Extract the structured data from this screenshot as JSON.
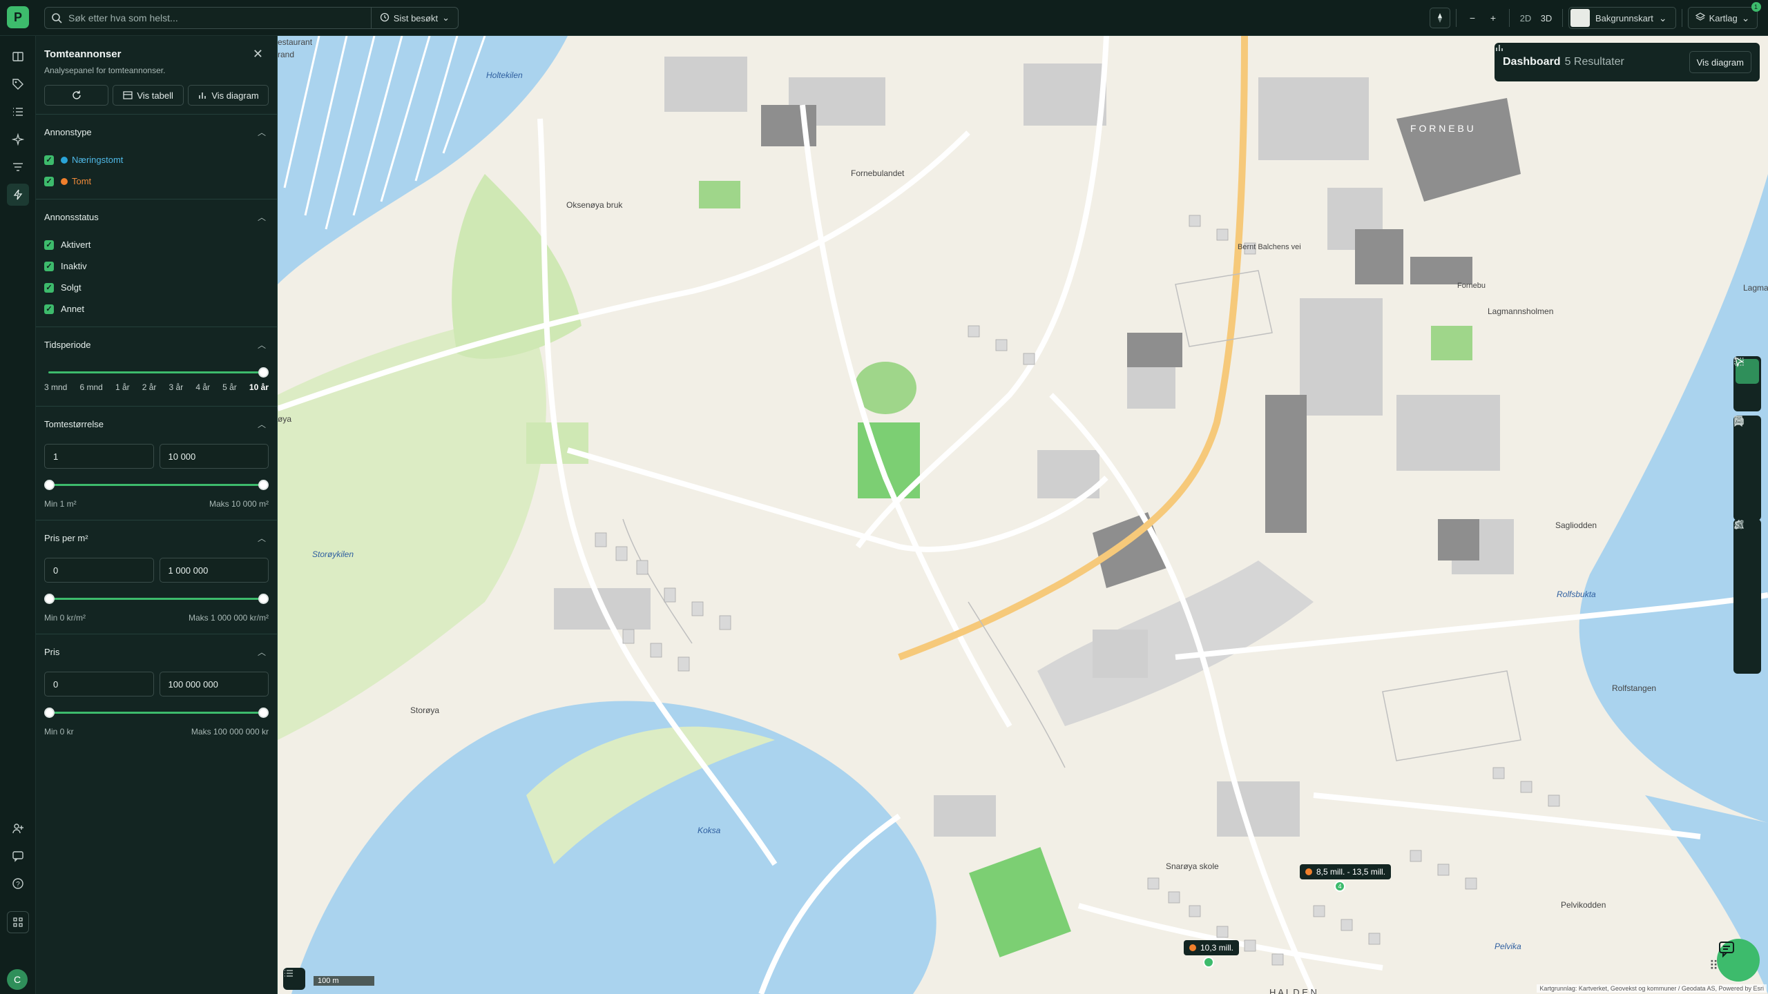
{
  "topbar": {
    "logo": "P",
    "search_placeholder": "Søk etter hva som helst...",
    "recent_label": "Sist besøkt",
    "zoom_out": "−",
    "zoom_in": "+",
    "mode_2d": "2D",
    "mode_3d": "3D",
    "basemap_label": "Bakgrunnskart",
    "layers_label": "Kartlag",
    "layers_badge": "1"
  },
  "user": {
    "initial": "C"
  },
  "panel": {
    "title": "Tomteannonser",
    "subtitle": "Analysepanel for tomteannonser.",
    "actions": {
      "table": "Vis tabell",
      "chart": "Vis diagram"
    },
    "annonstype": {
      "title": "Annonstype",
      "items": [
        {
          "label": "Næringstomt",
          "color": "#2aa4d8"
        },
        {
          "label": "Tomt",
          "color": "#ef7f2c"
        }
      ]
    },
    "status": {
      "title": "Annonsstatus",
      "items": [
        {
          "label": "Aktivert"
        },
        {
          "label": "Inaktiv"
        },
        {
          "label": "Solgt"
        },
        {
          "label": "Annet"
        }
      ]
    },
    "period": {
      "title": "Tidsperiode",
      "ticks": [
        "3 mnd",
        "6 mnd",
        "1 år",
        "2 år",
        "3 år",
        "4 år",
        "5 år",
        "10 år"
      ],
      "selected": "10 år"
    },
    "size": {
      "title": "Tomtestørrelse",
      "min": "1",
      "max": "10 000",
      "min_label": "Min 1 m²",
      "max_label": "Maks 10 000 m²"
    },
    "ppm": {
      "title": "Pris per m²",
      "min": "0",
      "max": "1 000 000",
      "min_label": "Min 0 kr/m²",
      "max_label": "Maks 1 000 000 kr/m²"
    },
    "price": {
      "title": "Pris",
      "min": "0",
      "max": "100 000 000",
      "min_label": "Min 0 kr",
      "max_label": "Maks 100 000 000 kr"
    }
  },
  "dashboard": {
    "title": "Dashboard",
    "results": "5 Resultater",
    "button": "Vis diagram"
  },
  "map": {
    "labels": {
      "holtekilen": "Holtekilen",
      "fornebulandet": "Fornebulandet",
      "oksenoya_bruk": "Oksenøya bruk",
      "fornebu": "F O R N E B U",
      "bernt": "Bernt Balchens vei",
      "lagmannsholmen": "Lagmannsholmen",
      "lagma": "Lagma",
      "storoykilen": "Storøykilen",
      "storoya": "Storøya",
      "saglisodden": "Sagliodden",
      "rolfsbukta": "Rolfsbukta",
      "rolfstangen": "Rolfstangen",
      "koksa": "Koksa",
      "snaroya_skole": "Snarøya skole",
      "pelvikodden": "Pelvikodden",
      "pelvika": "Pelvika",
      "halden": "H A L D E N",
      "fornebu_stop": "Fornebu",
      "oya": "øya",
      "restaurant": "estaurant",
      "rand": "rand"
    },
    "price_tags": [
      "8,5 mill. - 13,5 mill.",
      "10,3 mill."
    ],
    "pin_count": "4",
    "scale": "100 m",
    "attribution": "Kartgrunnlag: Kartverket, Geovekst og kommuner / Geodata AS, Powered by Esri"
  }
}
